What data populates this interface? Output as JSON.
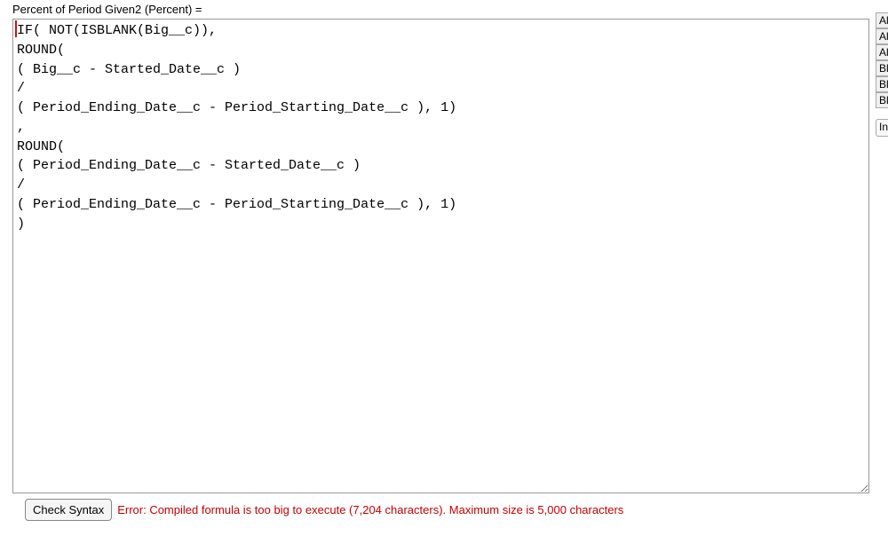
{
  "field_label": "Percent of Period Given2 (Percent) =",
  "formula_text": "IF( NOT(ISBLANK(Big__c)),\nROUND(\n( Big__c - Started_Date__c )\n/\n( Period_Ending_Date__c - Period_Starting_Date__c ), 1)\n,\nROUND(\n( Period_Ending_Date__c - Started_Date__c )\n/\n( Period_Ending_Date__c - Period_Starting_Date__c ), 1)\n)",
  "check_syntax_label": "Check Syntax",
  "error_message": "Error: Compiled formula is too big to execute (7,204 characters). Maximum size is 5,000 characters",
  "right_tabs": {
    "items": [
      "Al",
      "Al",
      "Al",
      "Bl",
      "Bl",
      "Bl"
    ],
    "insert_label": "In"
  }
}
